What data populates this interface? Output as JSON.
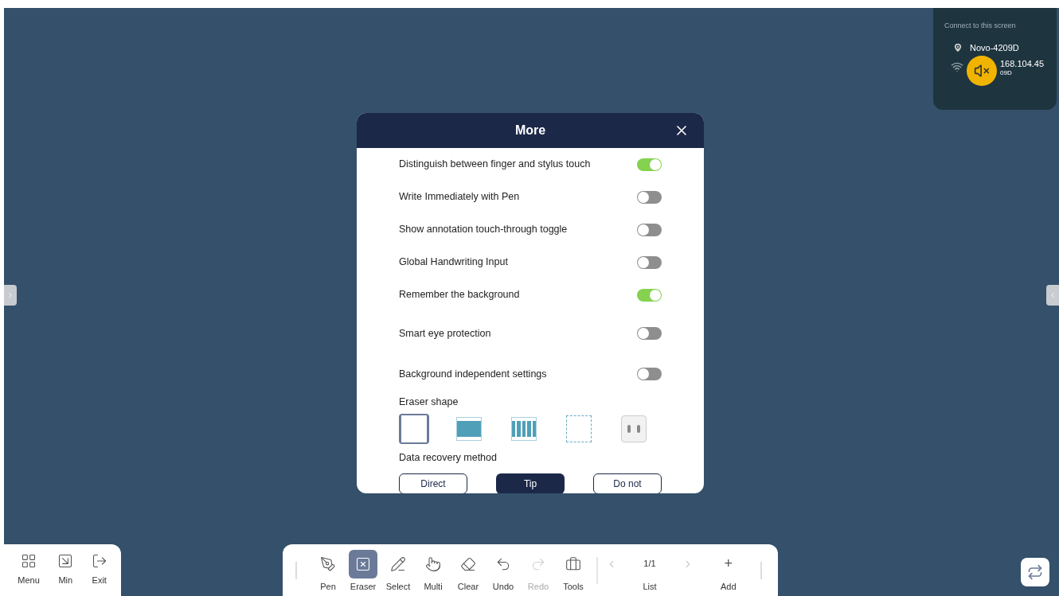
{
  "connect_panel": {
    "heading": "Connect to this screen",
    "device": "Novo-4209D",
    "ip_visible": "168.104.45",
    "name_visible": "09D"
  },
  "dialog": {
    "title": "More",
    "settings": [
      {
        "label": "Distinguish between finger and stylus touch",
        "on": true
      },
      {
        "label": "Write Immediately with Pen",
        "on": false
      },
      {
        "label": "Show annotation touch-through toggle",
        "on": false
      },
      {
        "label": "Global Handwriting Input",
        "on": false
      },
      {
        "label": "Remember the background",
        "on": true
      },
      {
        "label": "Smart eye protection",
        "on": false
      },
      {
        "label": "Background independent settings",
        "on": false
      }
    ],
    "eraser_label": "Eraser shape",
    "eraser_shapes": [
      {
        "kind": "outline",
        "selected": true
      },
      {
        "kind": "band",
        "selected": false
      },
      {
        "kind": "bars",
        "selected": false
      },
      {
        "kind": "dashed",
        "selected": false
      },
      {
        "kind": "pill",
        "selected": false
      }
    ],
    "recovery_label": "Data recovery method",
    "recovery_options": [
      {
        "label": "Direct",
        "selected": false
      },
      {
        "label": "Tip",
        "selected": true
      },
      {
        "label": "Do not",
        "selected": false
      }
    ]
  },
  "left_toolbar": [
    {
      "label": "Menu",
      "kind": "menu"
    },
    {
      "label": "Min",
      "kind": "min"
    },
    {
      "label": "Exit",
      "kind": "exit"
    }
  ],
  "tools": [
    {
      "label": "Pen",
      "kind": "pen",
      "selected": false,
      "disabled": false
    },
    {
      "label": "Eraser",
      "kind": "eraser",
      "selected": true,
      "disabled": false
    },
    {
      "label": "Select",
      "kind": "select",
      "selected": false,
      "disabled": false
    },
    {
      "label": "Multi",
      "kind": "multi",
      "selected": false,
      "disabled": false
    },
    {
      "label": "Clear",
      "kind": "clear",
      "selected": false,
      "disabled": false
    },
    {
      "label": "Undo",
      "kind": "undo",
      "selected": false,
      "disabled": false
    },
    {
      "label": "Redo",
      "kind": "redo",
      "selected": false,
      "disabled": true
    },
    {
      "label": "Tools",
      "kind": "tools",
      "selected": false,
      "disabled": false
    }
  ],
  "pages": {
    "current": "1/1",
    "label": "List"
  },
  "add": {
    "symbol": "+",
    "label": "Add"
  }
}
